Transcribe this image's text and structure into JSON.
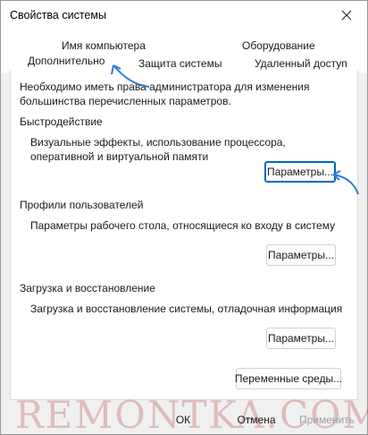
{
  "window": {
    "title": "Свойства системы"
  },
  "tabs": [
    {
      "label": "Имя компьютера"
    },
    {
      "label": "Оборудование"
    },
    {
      "label": "Дополнительно"
    },
    {
      "label": "Защита системы"
    },
    {
      "label": "Удаленный доступ"
    }
  ],
  "notice": "Необходимо иметь права администратора для изменения большинства перечисленных параметров.",
  "performance": {
    "title": "Быстродействие",
    "description": "Визуальные эффекты, использование процессора, оперативной и виртуальной памяти",
    "button": "Параметры..."
  },
  "profiles": {
    "title": "Профили пользователей",
    "description": "Параметры рабочего стола, относящиеся ко входу в систему",
    "button": "Параметры..."
  },
  "startup": {
    "title": "Загрузка и восстановление",
    "description": "Загрузка и восстановление системы, отладочная информация",
    "button": "Параметры..."
  },
  "env_button": "Переменные среды...",
  "footer": {
    "ok": "ОК",
    "cancel": "Отмена",
    "apply": "Применить"
  },
  "watermark": "REMONTKA.COM",
  "colors": {
    "accent": "#0067c0",
    "arrow": "#2a7fd4",
    "watermark": "#aa1e1e"
  }
}
